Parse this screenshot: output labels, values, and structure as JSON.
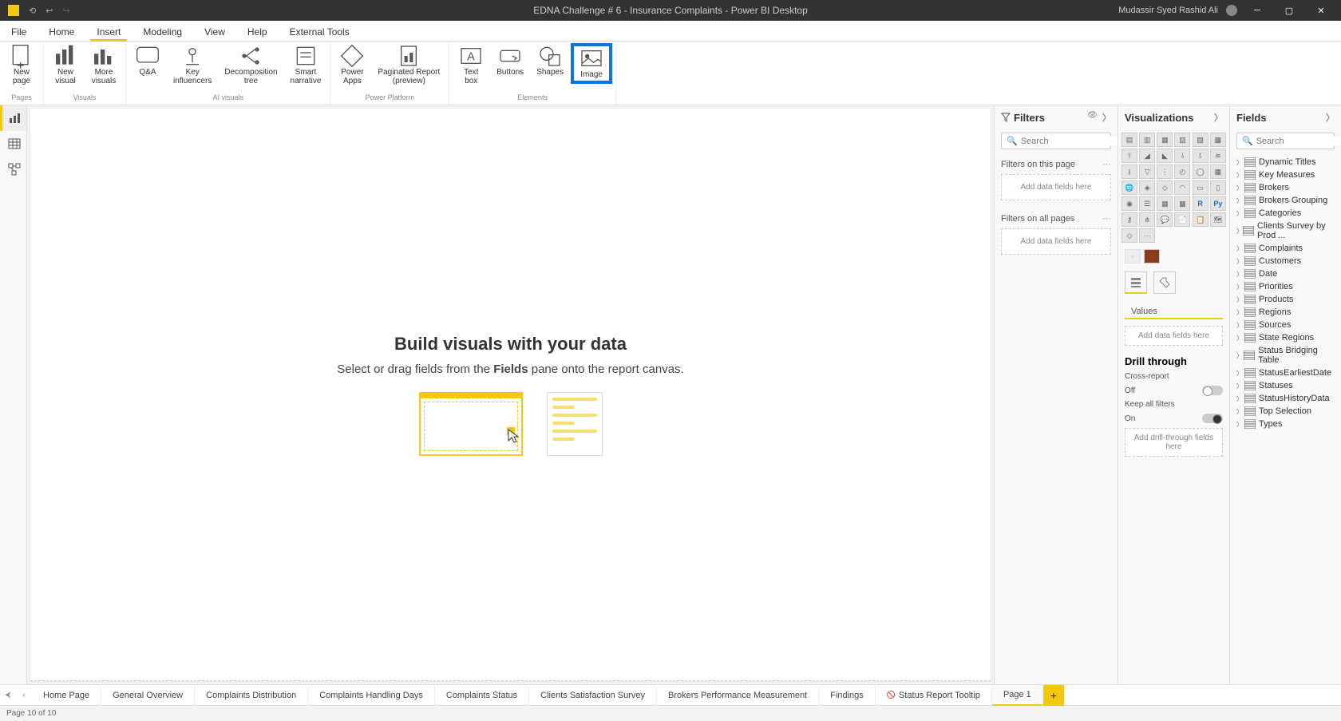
{
  "titlebar": {
    "title": "EDNA Challenge # 6 - Insurance Complaints - Power BI Desktop",
    "user": "Mudassir Syed Rashid Ali"
  },
  "menu": {
    "file": "File",
    "tabs": [
      "Home",
      "Insert",
      "Modeling",
      "View",
      "Help",
      "External Tools"
    ],
    "active": "Insert"
  },
  "ribbon": {
    "groups": [
      {
        "label": "Pages",
        "buttons": [
          {
            "label": "New\npage"
          }
        ]
      },
      {
        "label": "Visuals",
        "buttons": [
          {
            "label": "New\nvisual"
          },
          {
            "label": "More\nvisuals"
          }
        ]
      },
      {
        "label": "AI visuals",
        "buttons": [
          {
            "label": "Q&A"
          },
          {
            "label": "Key\ninfluencers"
          },
          {
            "label": "Decomposition\ntree"
          },
          {
            "label": "Smart\nnarrative"
          }
        ]
      },
      {
        "label": "Power Platform",
        "buttons": [
          {
            "label": "Power\nApps"
          },
          {
            "label": "Paginated Report\n(preview)"
          }
        ]
      },
      {
        "label": "Elements",
        "buttons": [
          {
            "label": "Text\nbox"
          },
          {
            "label": "Buttons"
          },
          {
            "label": "Shapes"
          },
          {
            "label": "Image",
            "highlighted": true
          }
        ]
      }
    ]
  },
  "canvas": {
    "title": "Build visuals with your data",
    "subtitle_pre": "Select or drag fields from the ",
    "subtitle_bold": "Fields",
    "subtitle_post": " pane onto the report canvas."
  },
  "filters": {
    "title": "Filters",
    "search_placeholder": "Search",
    "page_title": "Filters on this page",
    "all_title": "Filters on all pages",
    "drop_text": "Add data fields here"
  },
  "viz": {
    "title": "Visualizations",
    "values_label": "Values",
    "values_drop": "Add data fields here",
    "drill_title": "Drill through",
    "cross_report": "Cross-report",
    "off_label": "Off",
    "keep_filters": "Keep all filters",
    "on_label": "On",
    "drill_drop": "Add drill-through fields here"
  },
  "fields": {
    "title": "Fields",
    "search_placeholder": "Search",
    "items": [
      "Dynamic Titles",
      "Key Measures",
      "Brokers",
      "Brokers Grouping",
      "Categories",
      "Clients Survey by Prod ...",
      "Complaints",
      "Customers",
      "Date",
      "Priorities",
      "Products",
      "Regions",
      "Sources",
      "State Regions",
      "Status Bridging Table",
      "StatusEarliestDate",
      "Statuses",
      "StatusHistoryData",
      "Top Selection",
      "Types"
    ]
  },
  "pagetabs": {
    "tabs": [
      "Home Page",
      "General Overview",
      "Complaints Distribution",
      "Complaints Handling Days",
      "Complaints Status",
      "Clients Satisfaction Survey",
      "Brokers Performance Measurement",
      "Findings",
      "Status Report Tooltip",
      "Page 1"
    ],
    "active": "Page 1"
  },
  "statusbar": {
    "text": "Page 10 of 10"
  }
}
